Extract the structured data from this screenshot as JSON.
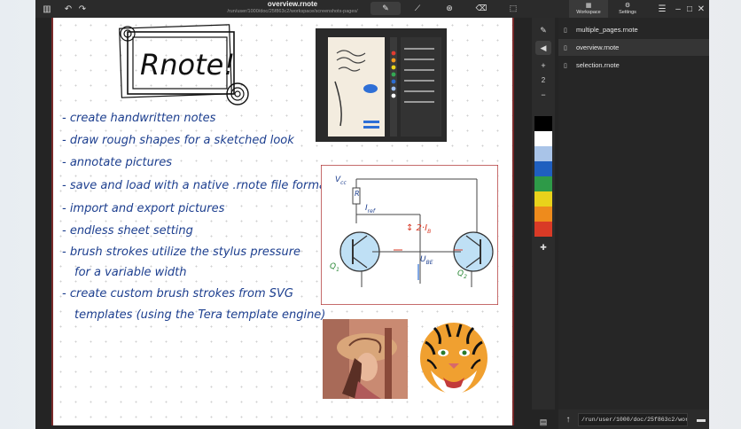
{
  "window": {
    "title": "overview.rnote",
    "path": "/run/user/1000/doc/25f863c2/workspace/screenshots-pages/"
  },
  "icons": {
    "menu": "sidebar-icon",
    "undo": "undo-icon",
    "redo": "redo-icon",
    "pen": "pen-icon",
    "shaper": "shaper-icon",
    "typewriter": "typewriter-icon",
    "eraser": "eraser-icon",
    "selector": "selector-icon"
  },
  "sidebar": {
    "page_number": "2",
    "colors": [
      "#000000",
      "#ffffff",
      "#a9c4e8",
      "#1f5fbf",
      "#2e9a48",
      "#e9d21b",
      "#ee8b1c",
      "#d93a26"
    ]
  },
  "workspace": {
    "tabs": [
      {
        "label": "Workspace",
        "icon": "workspace-icon"
      },
      {
        "label": "Settings",
        "icon": "gear-icon"
      }
    ],
    "files": [
      "multiple_pages.rnote",
      "overview.rnote",
      "selection.rnote"
    ],
    "path": "/run/user/1000/doc/25f863c2/work"
  },
  "canvas": {
    "logo": "Rnote!",
    "bullets": [
      "- create handwritten notes",
      "- draw rough shapes for a sketched look",
      "- annotate pictures",
      "- save and load with a native .rnote file format",
      "- import and export pictures",
      "- endless sheet setting",
      "- brush strokes utilize the stylus pressure",
      "for a variable width",
      "- create custom brush strokes from SVG",
      "templates (using the Tera template engine)"
    ],
    "circuit": {
      "vcc": "V",
      "vcc_sub": "cc",
      "r": "R",
      "iref": "I",
      "iref_sub": "ref",
      "current": "↕ 2·I",
      "current_sub": "B",
      "ube": "U",
      "ube_sub": "BE",
      "q1": "Q",
      "q1_sub": "1",
      "q2": "Q",
      "q2_sub": "2"
    }
  }
}
